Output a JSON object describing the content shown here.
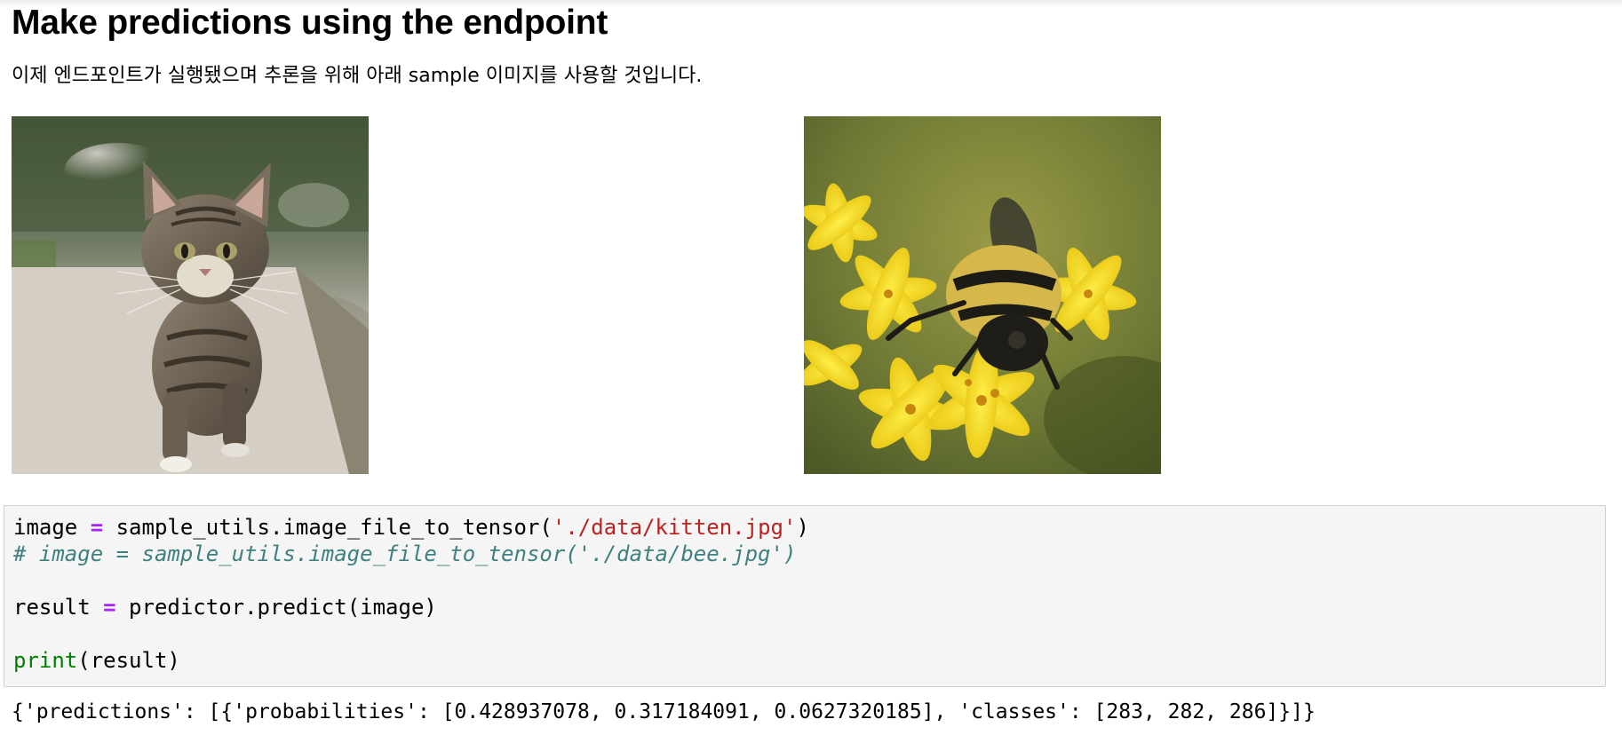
{
  "cell": {
    "heading": "Make predictions using the endpoint",
    "intro": "이제 엔드포인트가 실행됐으며 추론을 위해 아래 sample 이미지를 사용할 것입니다."
  },
  "images": {
    "kitten": {
      "subject": "tabby kitten walking on a stone ledge"
    },
    "bee": {
      "subject": "bumblebee on yellow flowers"
    }
  },
  "code": {
    "line1": {
      "var": "image ",
      "op": "=",
      "call": " sample_utils.image_file_to_tensor(",
      "arg": "'./data/kitten.jpg'",
      "close": ")"
    },
    "line2": {
      "comment": "# image = sample_utils.image_file_to_tensor('./data/bee.jpg')"
    },
    "line3": {
      "var": "result ",
      "op": "=",
      "call": " predictor.predict(image)"
    },
    "line4": {
      "builtin": "print",
      "args": "(result)"
    }
  },
  "output": {
    "text": "{'predictions': [{'probabilities': [0.428937078, 0.317184091, 0.0627320185], 'classes': [283, 282, 286]}]}"
  },
  "colors": {
    "operator": "#aa22ff",
    "string": "#ba2121",
    "comment": "#408080",
    "builtin": "#008000",
    "cell_background": "#f5f5f5",
    "cell_border": "#cfcfcf"
  }
}
